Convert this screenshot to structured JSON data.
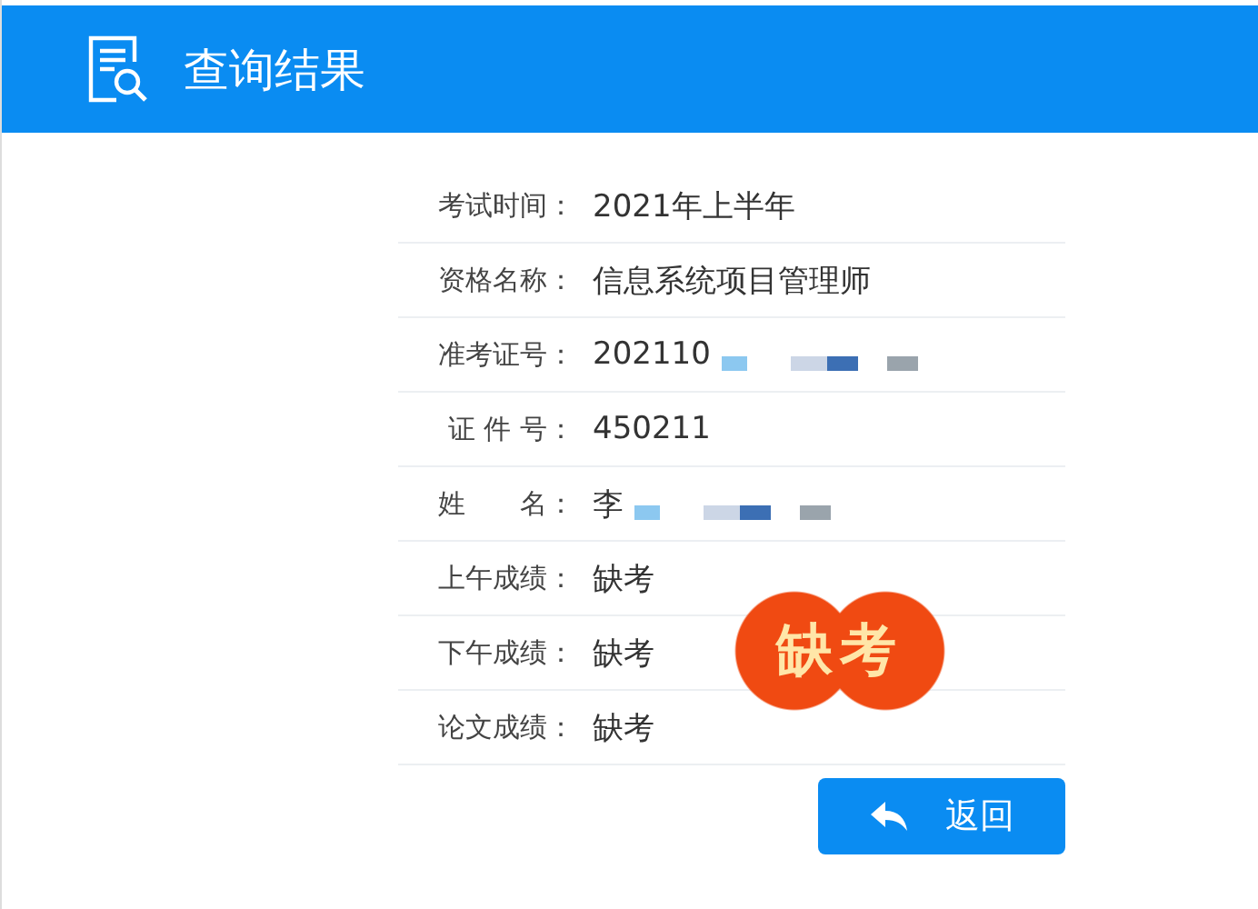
{
  "header": {
    "title": "查询结果"
  },
  "rows": [
    {
      "label": "考试时间：",
      "value": "2021年上半年"
    },
    {
      "label": "资格名称：",
      "value": "信息系统项目管理师"
    },
    {
      "label": "准考证号：",
      "value": "202110",
      "redacted": true
    },
    {
      "label": "证 件 号：",
      "value": "450211"
    },
    {
      "label": "姓　　名：",
      "value": "李",
      "redacted": true
    },
    {
      "label": "上午成绩：",
      "value": "缺考"
    },
    {
      "label": "下午成绩：",
      "value": "缺考"
    },
    {
      "label": "论文成绩：",
      "value": "缺考"
    }
  ],
  "stamp": {
    "text": "缺考"
  },
  "back_button": {
    "label": "返回"
  }
}
